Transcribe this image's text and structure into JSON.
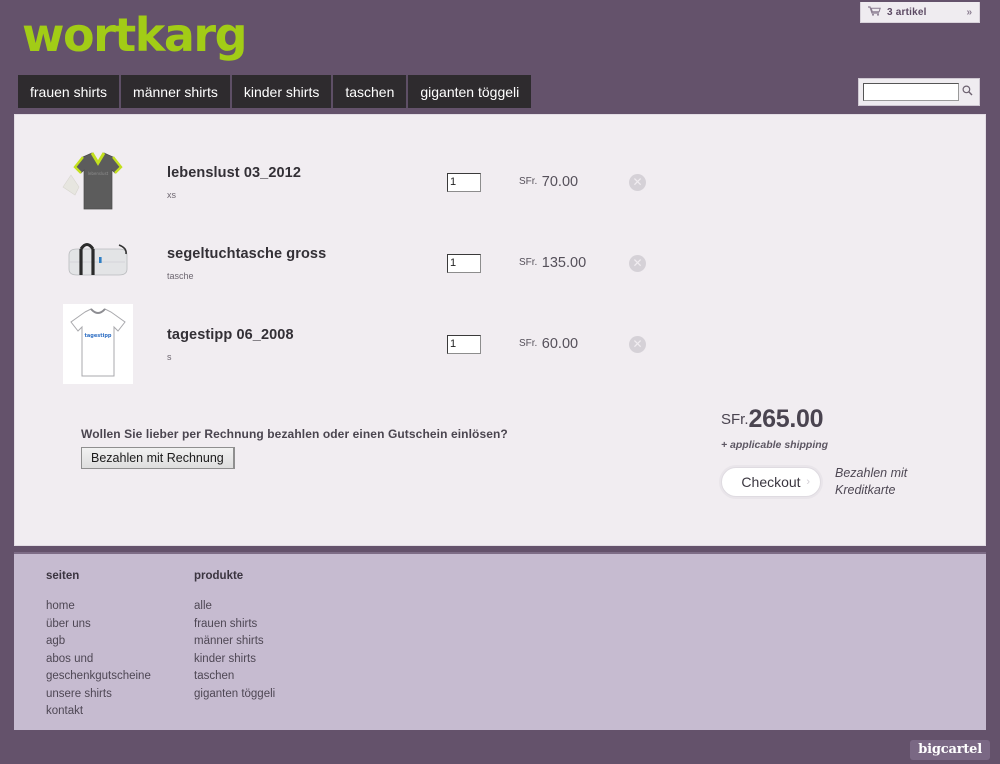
{
  "site": {
    "logo_text": "wortkarg",
    "logo_color": "#a2cc16",
    "background_color": "#64526b",
    "panel_color": "#f1edf1",
    "footer_color": "#c6bbd0"
  },
  "cart_bar": {
    "icon": "shopping-cart-icon",
    "label": "3 artikel",
    "arrows": "»"
  },
  "nav": {
    "items": [
      {
        "label": "frauen shirts"
      },
      {
        "label": "männer shirts"
      },
      {
        "label": "kinder shirts"
      },
      {
        "label": "taschen"
      },
      {
        "label": "giganten töggeli"
      }
    ]
  },
  "search": {
    "value": "",
    "placeholder": "",
    "icon": "search-icon"
  },
  "cart": {
    "items": [
      {
        "title": "lebenslust 03_2012",
        "variant": "xs",
        "quantity": "1",
        "currency": "SFr.",
        "price": "70.00",
        "thumb": "dark-grey-vneck-shirt",
        "remove_icon": "remove-item-icon"
      },
      {
        "title": "segeltuchtasche gross",
        "variant": "tasche",
        "quantity": "1",
        "currency": "SFr.",
        "price": "135.00",
        "thumb": "white-duffel-bag",
        "remove_icon": "remove-item-icon"
      },
      {
        "title": "tagestipp 06_2008",
        "variant": "s",
        "quantity": "1",
        "currency": "SFr.",
        "price": "60.00",
        "thumb": "white-tshirt",
        "remove_icon": "remove-item-icon"
      }
    ]
  },
  "invoice": {
    "question": "Wollen Sie lieber per Rechnung bezahlen oder einen Gutschein einlösen?",
    "button_label": "Bezahlen mit Rechnung"
  },
  "totals": {
    "currency": "SFr.",
    "amount": "265.00",
    "shipping_note": "+ applicable shipping",
    "checkout_label": "Checkout",
    "checkout_chevron": "›",
    "checkout_note": "Bezahlen mit\nKreditkarte"
  },
  "footer": {
    "columns": [
      {
        "heading": "seiten",
        "links": [
          "home",
          "über uns",
          "agb",
          "abos und",
          "geschenkgutscheine",
          "unsere shirts",
          "kontakt"
        ]
      },
      {
        "heading": "produkte",
        "links": [
          "alle",
          "frauen shirts",
          "männer shirts",
          "kinder shirts",
          "taschen",
          "giganten töggeli"
        ]
      }
    ],
    "badge": "bigcartel"
  }
}
